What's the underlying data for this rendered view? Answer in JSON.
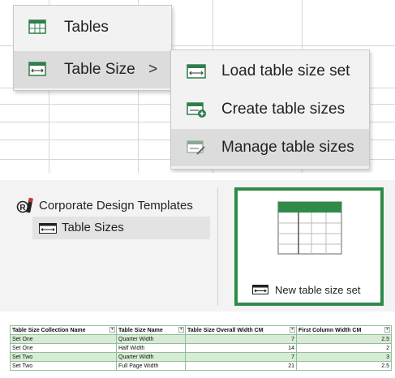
{
  "menu": {
    "items": [
      {
        "label": "Tables",
        "icon": "table-icon"
      },
      {
        "label": "Table Size",
        "icon": "table-size-icon",
        "arrow": ">"
      }
    ],
    "submenu": [
      {
        "label": "Load table size set",
        "icon": "load-table-size-icon"
      },
      {
        "label": "Create table sizes",
        "icon": "create-table-size-icon"
      },
      {
        "label": "Manage table sizes",
        "icon": "manage-table-size-icon"
      }
    ]
  },
  "tree": {
    "root_label": "Corporate Design Templates",
    "child_label": "Table Sizes"
  },
  "tile": {
    "label": "New table size set",
    "accent": "#2e8b4a"
  },
  "table": {
    "headers": [
      "Table Size Collection Name",
      "Table Size Name",
      "Table Size Overall Width CM",
      "First Column Width CM"
    ],
    "rows": [
      [
        "Set One",
        "Quarter Width",
        "7",
        "2.5"
      ],
      [
        "Set One",
        "Half Width",
        "14",
        "2"
      ],
      [
        "Set Two",
        "Quarter Width",
        "7",
        "3"
      ],
      [
        "Set Two",
        "Full Page Width",
        "21",
        "2.5"
      ]
    ]
  }
}
